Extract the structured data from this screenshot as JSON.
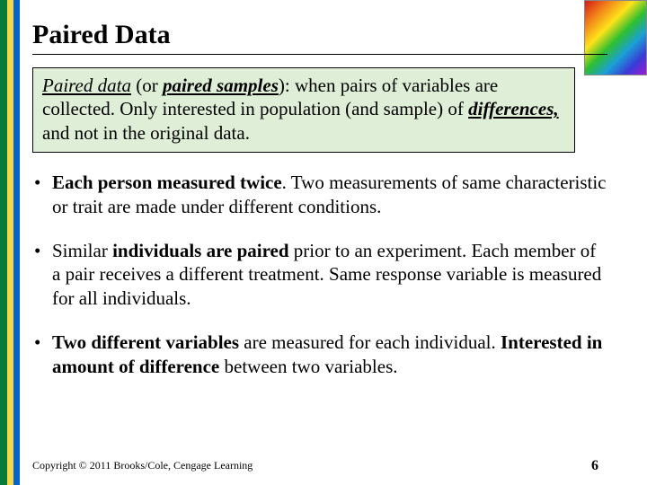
{
  "title": "Paired Data",
  "definition": {
    "term1": "Paired data",
    "paren_pre": " (or ",
    "term2": "paired samples",
    "paren_post": "):",
    "rest1": " when pairs of variables are collected. Only interested in population (and sample) of ",
    "term3": "differences,",
    "rest2": " and not in the original data."
  },
  "bullets": [
    {
      "b1": "Each person measured twice",
      "t1": ". Two measurements of same characteristic or trait are made under different conditions."
    },
    {
      "t1": "Similar ",
      "b1": "individuals are paired",
      "t2": " prior to an experiment. Each member of a pair receives a different treatment. Same response variable is measured for all individuals."
    },
    {
      "b1": "Two different variables",
      "t1": " are measured for each individual. ",
      "b2": "Interested in amount of difference",
      "t2": " between two variables."
    }
  ],
  "footer": "Copyright © 2011 Brooks/Cole, Cengage Learning",
  "page": "6"
}
